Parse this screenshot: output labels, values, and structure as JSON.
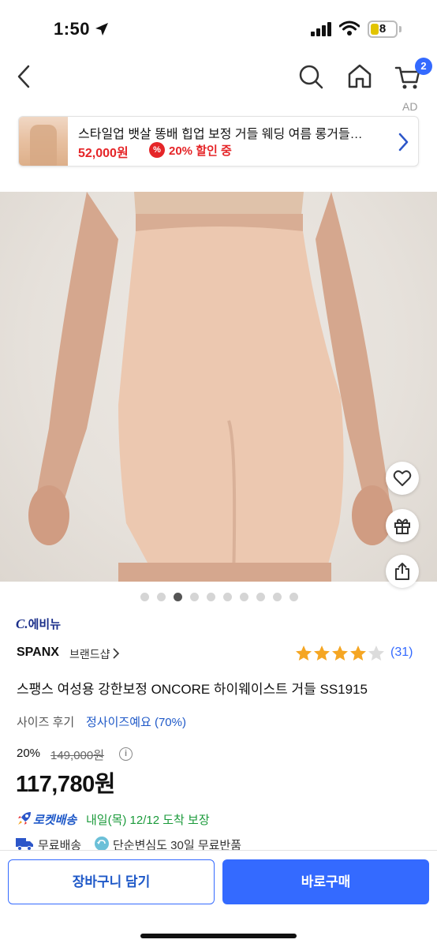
{
  "status_bar": {
    "time": "1:50",
    "battery": "8"
  },
  "nav": {
    "cart_count": "2",
    "ad_label": "AD"
  },
  "ad_banner": {
    "title": "스타일업 뱃살 똥배 힙업 보정 거들 웨딩 여름 롱거들…",
    "price": "52,000원",
    "pct_icon": "%",
    "discount": "20% 할인 중"
  },
  "gallery": {
    "total_images": 10,
    "active_index": 2
  },
  "product": {
    "brand_logo_mark": "C.",
    "brand_logo_text": "에비뉴",
    "brand": "SPANX",
    "brand_shop": "브랜드샵",
    "rating": 4,
    "rating_max": 5,
    "review_count": "(31)",
    "title": "스팽스 여성용 강한보정 ONCORE 하이웨이스트 거들 SS1915",
    "size_review_label": "사이즈 후기",
    "size_review_value": "정사이즈예요 (70%)",
    "discount_pct": "20%",
    "original_price": "149,000원",
    "info": "i",
    "sale_price": "117,780원",
    "rocket_label": "로켓배송",
    "delivery_eta": "내일(목) 12/12 도착 보장",
    "free_shipping": "무료배송",
    "return_policy": "단순변심도 30일 무료반품"
  },
  "actions": {
    "cart": "장바구니 담기",
    "buy": "바로구매"
  },
  "colors": {
    "accent": "#346aff",
    "sale_red": "#e52528",
    "eta_green": "#1a9a3a",
    "star": "#f5a623"
  }
}
